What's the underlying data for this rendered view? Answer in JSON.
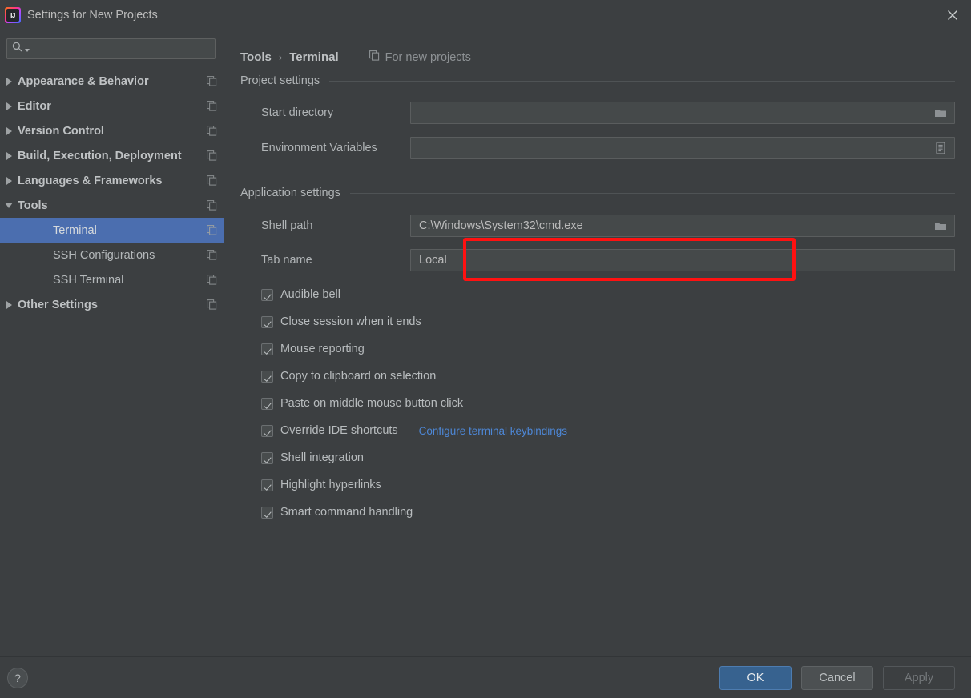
{
  "window": {
    "title": "Settings for New Projects",
    "logo_text": "IJ",
    "close_icon": "close-icon"
  },
  "search": {
    "value": "",
    "placeholder": "",
    "icon": "search-icon",
    "dropdown_icon": "chevron-down-icon"
  },
  "sidebar": {
    "items": [
      {
        "label": "Appearance & Behavior",
        "level": "top",
        "expanded": false,
        "selected": false
      },
      {
        "label": "Editor",
        "level": "top",
        "expanded": false,
        "selected": false
      },
      {
        "label": "Version Control",
        "level": "top",
        "expanded": false,
        "selected": false
      },
      {
        "label": "Build, Execution, Deployment",
        "level": "top",
        "expanded": false,
        "selected": false
      },
      {
        "label": "Languages & Frameworks",
        "level": "top",
        "expanded": false,
        "selected": false
      },
      {
        "label": "Tools",
        "level": "top",
        "expanded": true,
        "selected": false
      },
      {
        "label": "Terminal",
        "level": "child",
        "expanded": null,
        "selected": true
      },
      {
        "label": "SSH Configurations",
        "level": "child",
        "expanded": null,
        "selected": false
      },
      {
        "label": "SSH Terminal",
        "level": "child",
        "expanded": null,
        "selected": false
      },
      {
        "label": "Other Settings",
        "level": "top",
        "expanded": false,
        "selected": false
      }
    ],
    "row_icon": "copy-settings-icon"
  },
  "breadcrumb": {
    "parent": "Tools",
    "separator": "›",
    "current": "Terminal",
    "scope_label": "For new projects",
    "scope_icon": "copy-settings-icon"
  },
  "sections": [
    {
      "title": "Project settings"
    },
    {
      "title": "Application settings"
    }
  ],
  "fields": {
    "start_directory": {
      "label": "Start directory",
      "value": "",
      "placeholder": "",
      "button_icon": "folder-icon"
    },
    "environment_variables": {
      "label": "Environment Variables",
      "value": "",
      "placeholder": "",
      "button_icon": "env-list-icon"
    },
    "shell_path": {
      "label": "Shell path",
      "value": "C:\\Windows\\System32\\cmd.exe",
      "placeholder": "",
      "button_icon": "folder-icon"
    },
    "tab_name": {
      "label": "Tab name",
      "value": "Local",
      "placeholder": ""
    }
  },
  "checkboxes": [
    {
      "label": "Audible bell",
      "checked": true,
      "link": null
    },
    {
      "label": "Close session when it ends",
      "checked": true,
      "link": null
    },
    {
      "label": "Mouse reporting",
      "checked": true,
      "link": null
    },
    {
      "label": "Copy to clipboard on selection",
      "checked": true,
      "link": null
    },
    {
      "label": "Paste on middle mouse button click",
      "checked": true,
      "link": null
    },
    {
      "label": "Override IDE shortcuts",
      "checked": true,
      "link": "Configure terminal keybindings"
    },
    {
      "label": "Shell integration",
      "checked": true,
      "link": null
    },
    {
      "label": "Highlight hyperlinks",
      "checked": true,
      "link": null
    },
    {
      "label": "Smart command handling",
      "checked": true,
      "link": null
    }
  ],
  "footer": {
    "help_label": "?",
    "ok_label": "OK",
    "cancel_label": "Cancel",
    "apply_label": "Apply",
    "apply_enabled": false
  },
  "annotation": {
    "color": "#ff1111",
    "target": "shell-path-row"
  },
  "colors": {
    "window_bg": "#3c3f41",
    "selection_blue": "#4b6eaf",
    "link_blue": "#4d87d6",
    "primary_button": "#37628f",
    "annotation_red": "#ff1111",
    "text": "#bbbbbb"
  }
}
